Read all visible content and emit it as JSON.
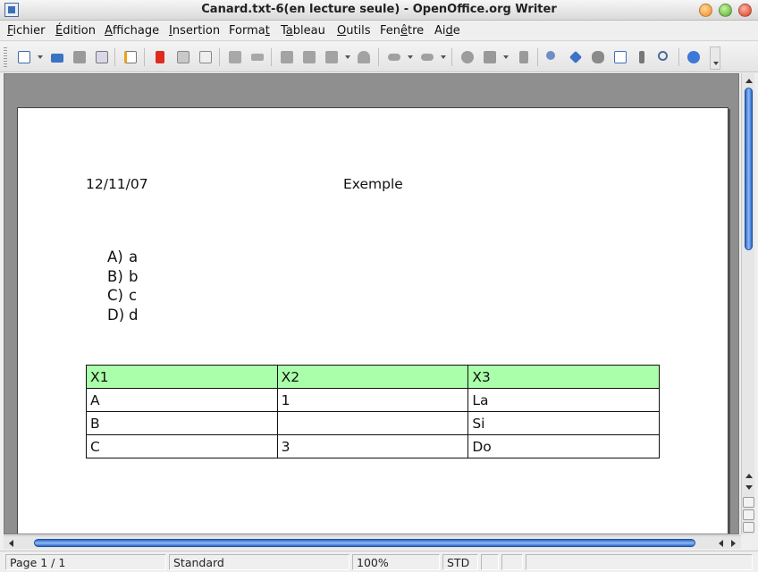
{
  "window": {
    "title": "Canard.txt-6(en lecture seule) - OpenOffice.org Writer"
  },
  "menu": {
    "items": [
      "Fichier",
      "Édition",
      "Affichage",
      "Insertion",
      "Format",
      "Tableau",
      "Outils",
      "Fenêtre",
      "Aide"
    ]
  },
  "toolbar": {
    "icons": [
      "show-draw-functions-icon",
      "open-icon",
      "save-icon",
      "email-document-icon",
      "edit-file-icon",
      "export-pdf-icon",
      "print-icon",
      "page-preview-icon",
      "spellcheck-icon",
      "autospellcheck-icon",
      "cut-icon",
      "copy-icon",
      "paste-icon",
      "clone-formatting-icon",
      "undo-icon",
      "redo-icon",
      "hyperlink-icon",
      "table-icon",
      "show-draw-icon",
      "find-replace-icon",
      "navigator-icon",
      "gallery-icon",
      "data-sources-icon",
      "nonprinting-characters-icon",
      "zoom-icon",
      "help-icon"
    ]
  },
  "document": {
    "header_left": "12/11/07",
    "header_center": "Exemple",
    "list": [
      {
        "marker": "A)",
        "text": "a"
      },
      {
        "marker": "B)",
        "text": "b"
      },
      {
        "marker": "C)",
        "text": "c"
      },
      {
        "marker": "D)",
        "text": "d"
      }
    ],
    "table": {
      "header": [
        "X1",
        "X2",
        "X3"
      ],
      "rows": [
        [
          "A",
          "1",
          "La"
        ],
        [
          "B",
          "",
          "Si"
        ],
        [
          "C",
          "3",
          "Do"
        ]
      ],
      "header_color": "#aaffaa"
    }
  },
  "statusbar": {
    "page": "Page 1 / 1",
    "style": "Standard",
    "zoom": "100%",
    "mode": "STD"
  },
  "colors": {
    "scroll_thumb": "#4a86e0",
    "table_header": "#aaffaa",
    "doc_background": "#8f8f8f"
  }
}
